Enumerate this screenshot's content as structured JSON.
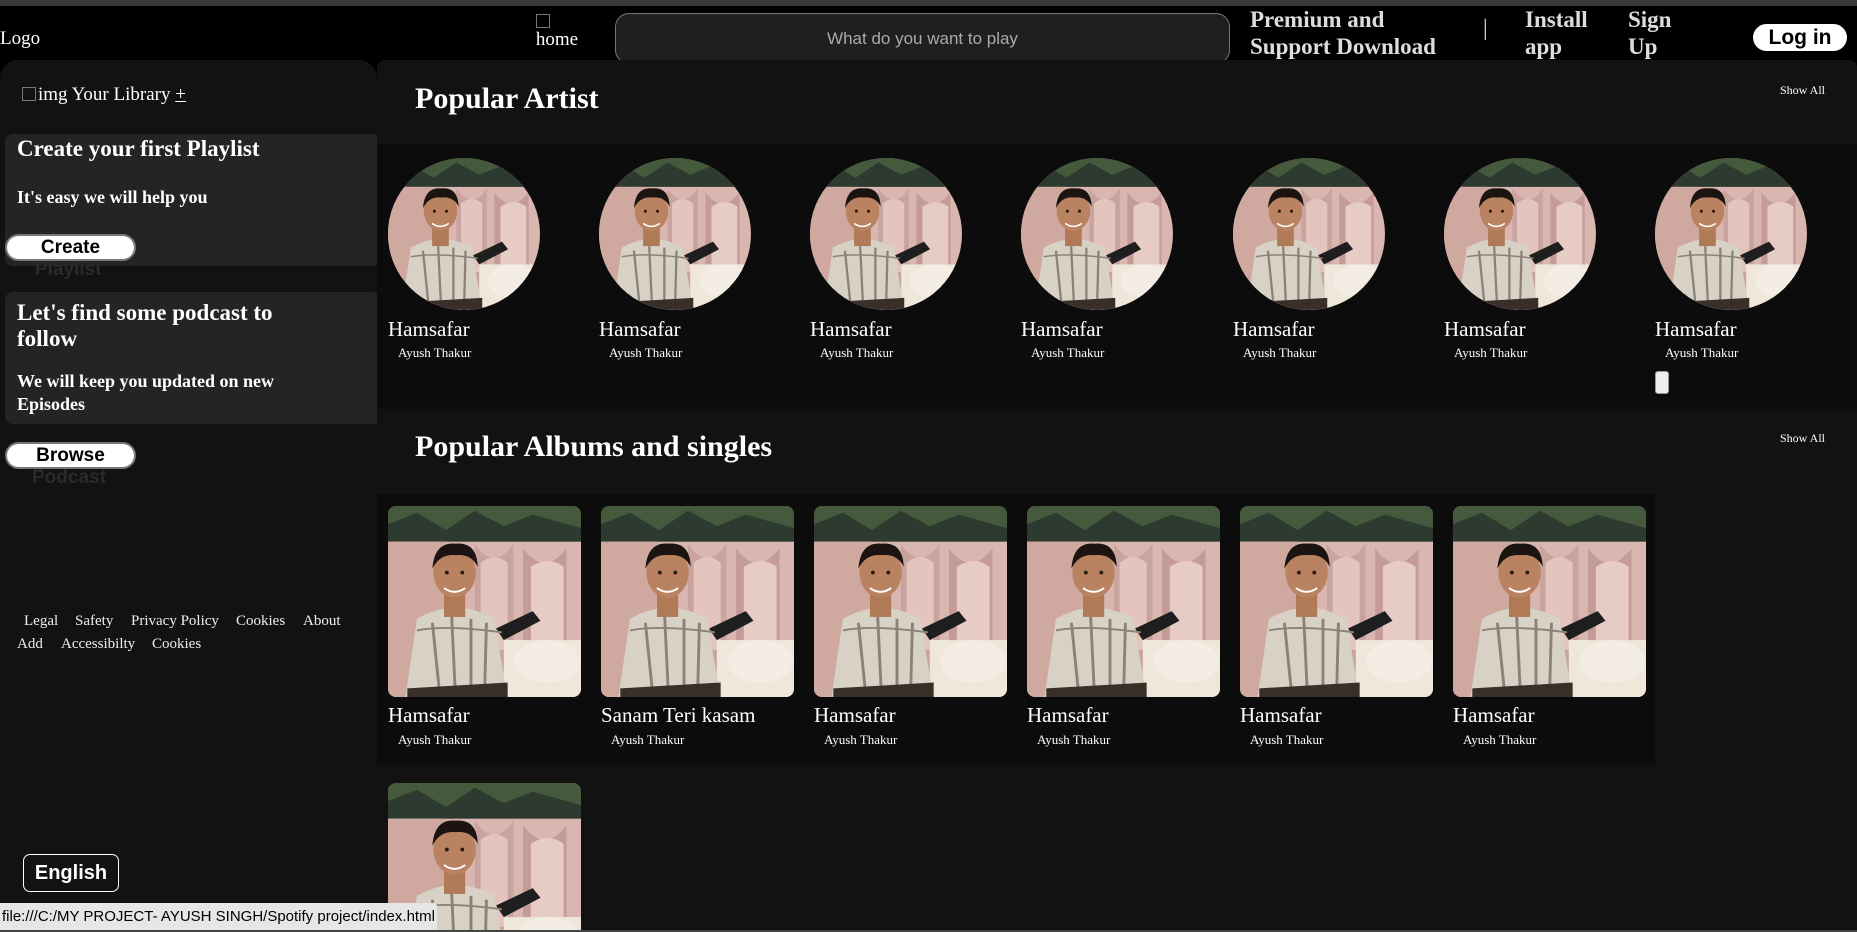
{
  "topbar": {
    "logo_alt": "Logo",
    "home_alt": "home",
    "search_placeholder": "What do you want to play",
    "premium_line1": "Premium and",
    "premium_line2": "Support Download",
    "separator": "|",
    "install_line1": "Install",
    "install_line2": "app",
    "signup_line1": "Sign",
    "signup_line2": "Up",
    "login": "Log in"
  },
  "sidebar": {
    "library_img_alt": "img",
    "library_label": "Your Library",
    "library_plus": "+",
    "playlist_card": {
      "title": "Create your first Playlist",
      "text": "It's easy we will help you",
      "button": "Create",
      "button_overflow": "Playlist"
    },
    "podcast_card": {
      "title_line1": "Let's find some podcast to",
      "title_line2": "follow",
      "text_line1": "We will keep you updated on new",
      "text_line2": "Episodes",
      "button": "Browse",
      "button_overflow": "Podcast"
    },
    "footer_row1": [
      "Legal",
      "Safety",
      "Privacy Policy",
      "Cookies",
      "About"
    ],
    "footer_row2": [
      "Add",
      "Accessibilty",
      "Cookies"
    ],
    "language": "English"
  },
  "main": {
    "popular_artist": {
      "title": "Popular Artist",
      "show_all": "Show All",
      "items": [
        {
          "name": "Hamsafar",
          "artist": "Ayush Thakur"
        },
        {
          "name": "Hamsafar",
          "artist": "Ayush Thakur"
        },
        {
          "name": "Hamsafar",
          "artist": "Ayush Thakur"
        },
        {
          "name": "Hamsafar",
          "artist": "Ayush Thakur"
        },
        {
          "name": "Hamsafar",
          "artist": "Ayush Thakur"
        },
        {
          "name": "Hamsafar",
          "artist": "Ayush Thakur"
        },
        {
          "name": "Hamsafar",
          "artist": "Ayush Thakur"
        }
      ]
    },
    "popular_albums": {
      "title": "Popular Albums and singles",
      "show_all": "Show All",
      "items": [
        {
          "name": "Hamsafar",
          "artist": "Ayush Thakur"
        },
        {
          "name": "Sanam Teri kasam",
          "artist": "Ayush Thakur"
        },
        {
          "name": "Hamsafar",
          "artist": "Ayush Thakur"
        },
        {
          "name": "Hamsafar",
          "artist": "Ayush Thakur"
        },
        {
          "name": "Hamsafar",
          "artist": "Ayush Thakur"
        },
        {
          "name": "Hamsafar",
          "artist": "Ayush Thakur"
        },
        {
          "name": "",
          "artist": ""
        }
      ]
    }
  },
  "statusbar": {
    "url": "file:///C:/MY PROJECT- AYUSH SINGH/Spotify project/index.html"
  },
  "colors": {
    "background": "#000000",
    "panel": "#121212",
    "card": "#242424",
    "text": "#ffffff"
  }
}
